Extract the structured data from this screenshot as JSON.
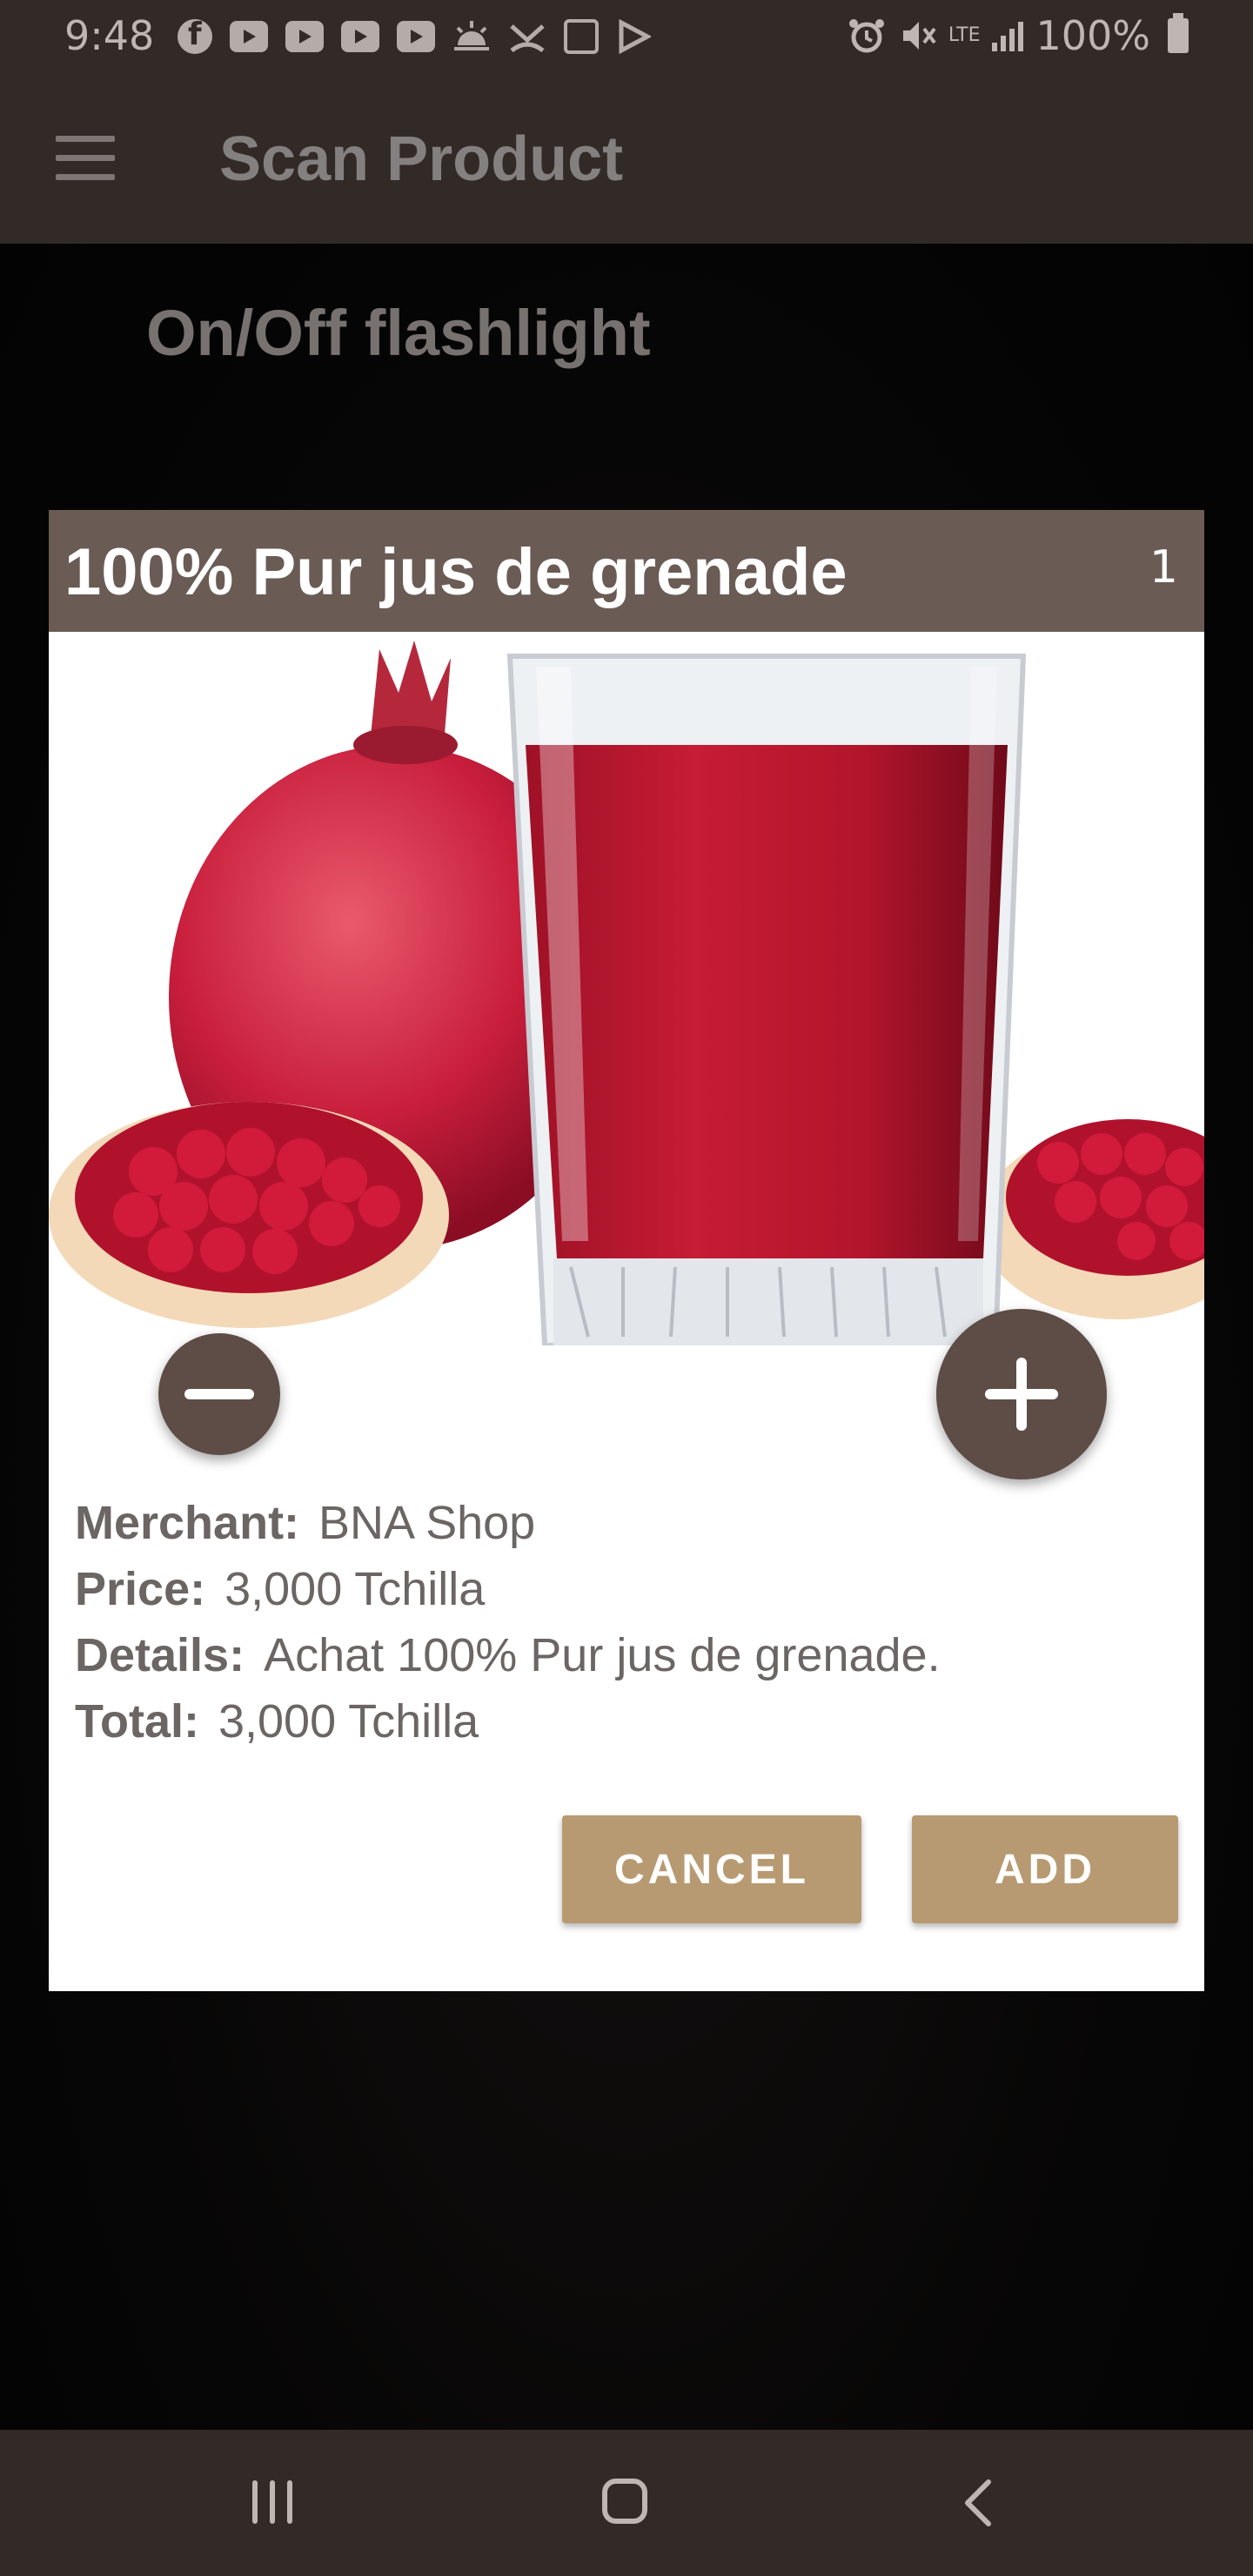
{
  "status_bar": {
    "time": "9:48",
    "battery": "100%",
    "network": "LTE"
  },
  "app_bar": {
    "title": "Scan Product"
  },
  "camera_overlay": {
    "flashlight_label": "On/Off flashlight"
  },
  "dialog": {
    "title": "100% Pur jus de grenade",
    "quantity": "1",
    "info": {
      "merchant_label": "Merchant:",
      "merchant_value": "BNA Shop",
      "price_label": "Price:",
      "price_value": "3,000 Tchilla",
      "details_label": "Details:",
      "details_value": "Achat 100% Pur jus de grenade.",
      "total_label": "Total:",
      "total_value": "3,000 Tchilla"
    },
    "cancel_label": "CANCEL",
    "add_label": "ADD"
  },
  "colors": {
    "bar_bg": "#312a27",
    "dialog_header": "#6b5b55",
    "button_bg": "#b89a72",
    "qty_button": "#5e4c47"
  }
}
